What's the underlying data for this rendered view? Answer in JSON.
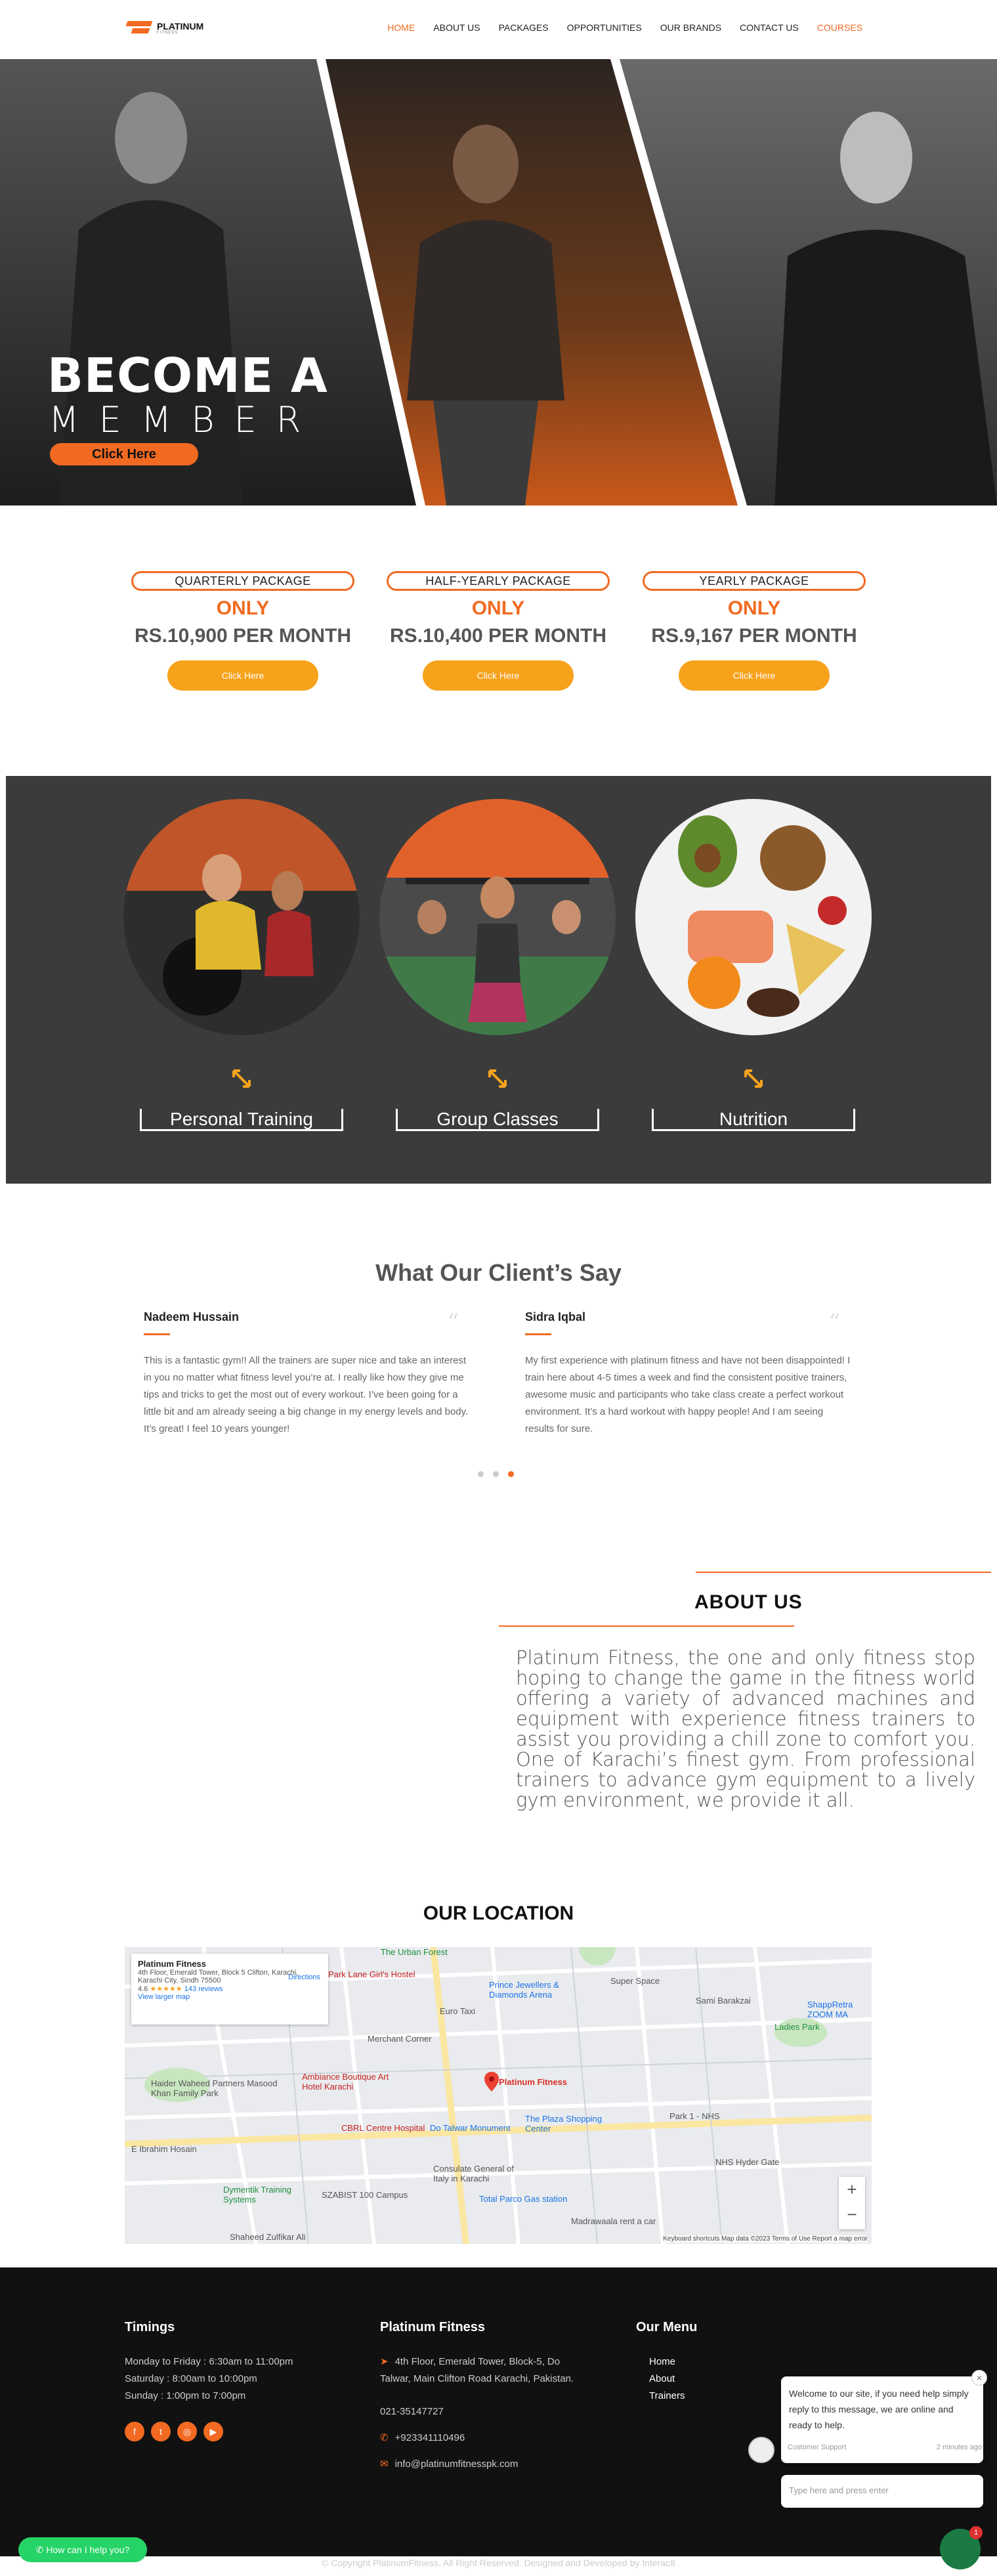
{
  "header": {
    "brand": "PLATINUM",
    "brand_sub": "FITNESS",
    "nav": [
      {
        "label": "HOME",
        "active": true
      },
      {
        "label": "ABOUT US",
        "active": false
      },
      {
        "label": "PACKAGES",
        "active": false
      },
      {
        "label": "OPPORTUNITIES",
        "active": false
      },
      {
        "label": "OUR BRANDS",
        "active": false
      },
      {
        "label": "CONTACT US",
        "active": false
      },
      {
        "label": "COURSES",
        "active": true
      }
    ]
  },
  "hero": {
    "title": "BECOME A",
    "subtitle": "MEMBER",
    "button": "Click Here"
  },
  "packages": [
    {
      "name": "QUARTERLY PACKAGE",
      "only": "ONLY",
      "price": "RS.10,900 PER MONTH",
      "button": "Click Here"
    },
    {
      "name": "HALF-YEARLY PACKAGE",
      "only": "ONLY",
      "price": "RS.10,400 PER MONTH",
      "button": "Click Here"
    },
    {
      "name": "YEARLY PACKAGE",
      "only": "ONLY",
      "price": "RS.9,167 PER MONTH",
      "button": "Click Here"
    }
  ],
  "services": [
    {
      "label": "Personal Training"
    },
    {
      "label": "Group Classes"
    },
    {
      "label": "Nutrition"
    }
  ],
  "testimonials": {
    "title": "What Our Client’s Say",
    "items": [
      {
        "name": "Nadeem Hussain",
        "text": "This is a fantastic gym!! All the trainers are super nice and take an interest in you no matter what fitness level you’re at. I really like how they give me tips and tricks to get the most out of every workout. I’ve been going for a little bit and am already seeing a big change in my energy levels and body. It’s great! I feel 10 years younger!"
      },
      {
        "name": "Sidra Iqbal",
        "text": "My first experience with platinum fitness and have not been disappointed! I train here about 4-5 times a week and find the consistent positive trainers, awesome music and participants who take class create a perfect workout environment. It’s a hard workout with happy people! And I am seeing results for sure."
      }
    ]
  },
  "about": {
    "title": "ABOUT US",
    "text": "Platinum Fitness, the one and only fitness stop hoping to change the game in the fitness world offering a variety of advanced machines and equipment with experience fitness trainers to assist you providing a chill zone to comfort you. One of Karachi’s finest gym. From professional trainers to advance gym equipment to a lively gym environment, we provide it all."
  },
  "location": {
    "title": "OUR LOCATION",
    "card_title": "Platinum Fitness",
    "card_address": "4th Floor, Emerald Tower, Block 5 Clifton, Karachi, Karachi City, Sindh 75500",
    "card_rating": "4.6",
    "card_reviews": "143 reviews",
    "card_larger": "View larger map",
    "card_directions": "Directions",
    "pin_label": "Platinum Fitness",
    "labels": [
      "The Urban Forest",
      "Park Lane Girl's Hostel",
      "Prince Jewellers & Diamonds Arena",
      "Super Space",
      "Sami Barakzai",
      "ShappRetra ZOOM MA",
      "Ladies Park",
      "Merchant Corner",
      "Euro Taxi",
      "Haider Waheed Partners Masood Khan Family Park",
      "Ambiance Boutique Art Hotel Karachi",
      "CBRL Centre Hospital",
      "Do Talwar Monument",
      "The Plaza Shopping Center",
      "Park 1 - NHS",
      "NHS Hyder Gate",
      "Dymentik Training Systems",
      "SZABIST 100 Campus",
      "Consulate General of Italy in Karachi",
      "Total Parco Gas station",
      "Madrawaala rent a car",
      "Shaheed Zulfikar Ali",
      "E Ibrahim Hosain"
    ],
    "footer": "Keyboard shortcuts   Map data ©2023   Terms of Use   Report a map error"
  },
  "footer": {
    "timings_title": "Timings",
    "timings": [
      "Monday to Friday : 6:30am to 11:00pm",
      "Saturday : 8:00am to 10:00pm",
      "Sunday : 1:00pm to 7:00pm"
    ],
    "company_title": "Platinum Fitness",
    "address": "4th Floor, Emerald Tower, Block-5, Do Talwar, Main Clifton Road Karachi, Pakistan.",
    "phone1": "021-35147727",
    "phone2": "+923341110496",
    "email": "info@platinumfitnesspk.com",
    "menu_title": "Our Menu",
    "menu": [
      "Home",
      "About",
      "Trainers"
    ],
    "copyright": "© Copyright PlatinumFitness. All Right Reserved. Designed and Developed by Interac8"
  },
  "chat": {
    "message": "Welcome to our site, if you need help simply reply to this message, we are online and ready to help.",
    "agent": "Customer Support",
    "time": "2 minutes ago",
    "placeholder": "Type here and press enter",
    "badge": "1",
    "whatsapp": "How can I help you?"
  },
  "colors": {
    "accent": "#f26a21",
    "button": "#f7a21b",
    "dark": "#3b3b3b",
    "footer": "#111111"
  }
}
